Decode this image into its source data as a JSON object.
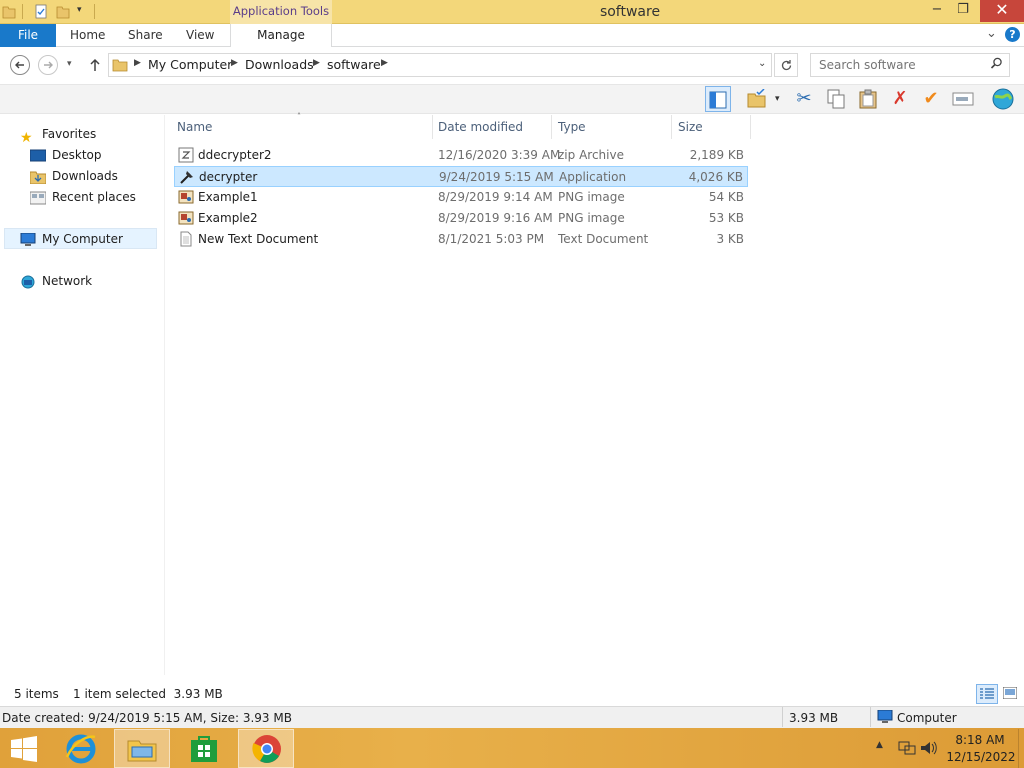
{
  "window": {
    "title": "software",
    "context_tab": "Application Tools",
    "minimize": "−",
    "maximize": "❐",
    "close": "✕"
  },
  "ribbon": {
    "tabs": [
      "File",
      "Home",
      "Share",
      "View"
    ],
    "context_tab": "Manage",
    "collapse": "⌄",
    "help": "?"
  },
  "address": {
    "crumbs": [
      "My Computer",
      "Downloads",
      "software"
    ],
    "search_placeholder": "Search software"
  },
  "nav": {
    "favorites": "Favorites",
    "favorites_items": [
      "Desktop",
      "Downloads",
      "Recent places"
    ],
    "computer": "My Computer",
    "network": "Network"
  },
  "columns": {
    "name": "Name",
    "date": "Date modified",
    "type": "Type",
    "size": "Size"
  },
  "files": [
    {
      "name": "ddecrypter2",
      "date": "12/16/2020 3:39 AM",
      "type": "zip Archive",
      "size": "2,189 KB",
      "icon": "zip-icon",
      "selected": false
    },
    {
      "name": "decrypter",
      "date": "9/24/2019 5:15 AM",
      "type": "Application",
      "size": "4,026 KB",
      "icon": "application-icon",
      "selected": true
    },
    {
      "name": "Example1",
      "date": "8/29/2019 9:14 AM",
      "type": "PNG image",
      "size": "54 KB",
      "icon": "image-icon",
      "selected": false
    },
    {
      "name": "Example2",
      "date": "8/29/2019 9:16 AM",
      "type": "PNG image",
      "size": "53 KB",
      "icon": "image-icon",
      "selected": false
    },
    {
      "name": "New Text Document",
      "date": "8/1/2021 5:03 PM",
      "type": "Text Document",
      "size": "3 KB",
      "icon": "text-file-icon",
      "selected": false
    }
  ],
  "status": {
    "count": "5 items",
    "selection": "1 item selected  3.93 MB"
  },
  "details": {
    "info": "Date created: 9/24/2019 5:15 AM, Size: 3.93 MB",
    "size": "3.93 MB",
    "location": "Computer"
  },
  "taskbar": {
    "time": "8:18 AM",
    "date": "12/15/2022"
  },
  "colors": {
    "title_bar": "#f3d77a",
    "file_tab": "#1979ca",
    "selection": "#cce8ff",
    "taskbar": "#e0a13a"
  }
}
